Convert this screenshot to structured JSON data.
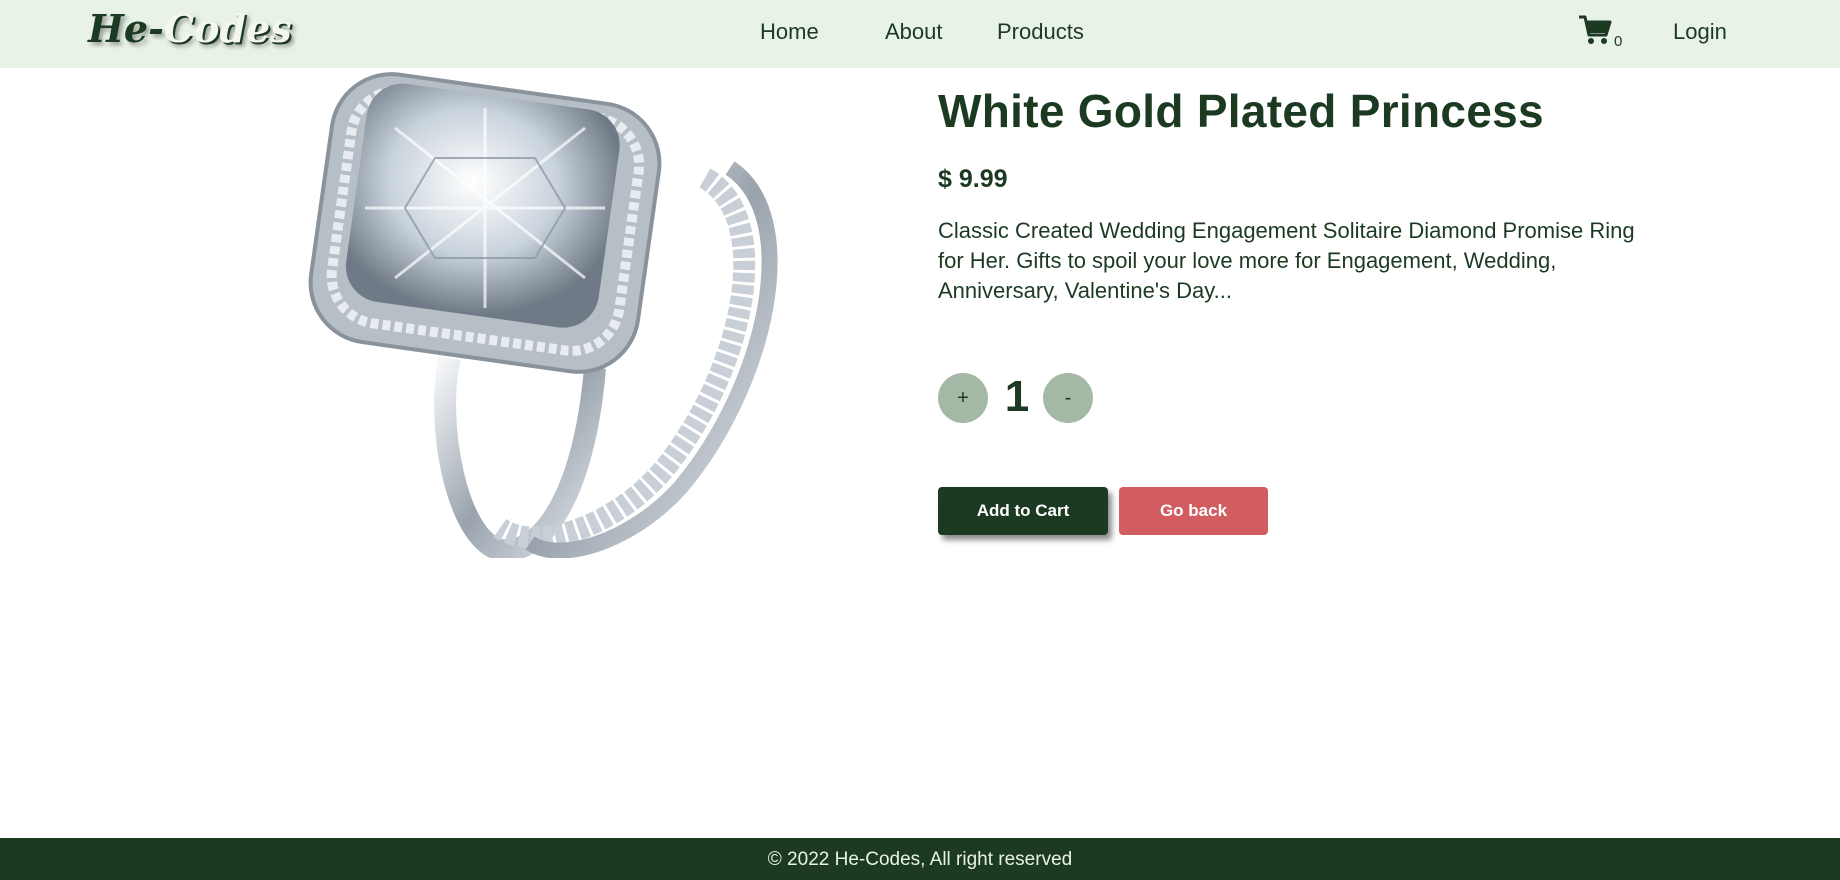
{
  "header": {
    "logo_prefix": "He-",
    "logo_suffix": "Codes",
    "nav": [
      {
        "label": "Home"
      },
      {
        "label": "About"
      },
      {
        "label": "Products"
      }
    ],
    "cart_count": "0",
    "login_label": "Login"
  },
  "product": {
    "title": "White Gold Plated Princess",
    "price": "$ 9.99",
    "description": "Classic Created Wedding Engagement Solitaire Diamond Promise Ring for Her. Gifts to spoil your love more for Engagement, Wedding, Anniversary, Valentine's Day...",
    "quantity": "1",
    "increment_label": "+",
    "decrement_label": "-",
    "image_icon": "ring-image"
  },
  "actions": {
    "add_to_cart_label": "Add to Cart",
    "go_back_label": "Go back"
  },
  "footer": {
    "copyright": "© 2022 He-Codes, All right reserved"
  },
  "colors": {
    "primary": "#1c3a22",
    "header_bg": "#e8f2e6",
    "qty_button": "#a3b9a6",
    "go_back": "#d15d60"
  }
}
